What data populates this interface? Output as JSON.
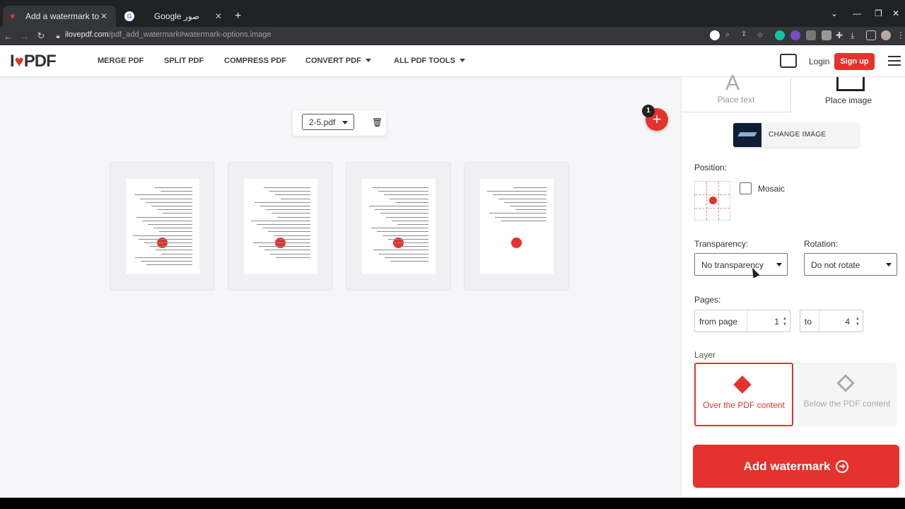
{
  "browser": {
    "tabs": [
      {
        "title": "Add a watermark to a PDF. Add",
        "active": true
      },
      {
        "title": "Google صور",
        "active": false
      }
    ],
    "url": {
      "domain": "ilovepdf.com",
      "path": "/pdf_add_watermark#watermark-options.image"
    }
  },
  "header": {
    "logo": {
      "left": "I",
      "right": "PDF"
    },
    "menu": [
      {
        "label": "MERGE PDF",
        "dropdown": false
      },
      {
        "label": "SPLIT PDF",
        "dropdown": false
      },
      {
        "label": "COMPRESS PDF",
        "dropdown": false
      },
      {
        "label": "CONVERT PDF",
        "dropdown": true
      },
      {
        "label": "ALL PDF TOOLS",
        "dropdown": true
      }
    ],
    "login": "Login",
    "signup": "Sign up"
  },
  "workspace": {
    "file_select": "2-5.pdf",
    "file_count": "1",
    "add_button": "+",
    "pages": 4
  },
  "panel": {
    "modes": {
      "text": "Place text",
      "image": "Place image"
    },
    "change_image": "CHANGE IMAGE",
    "position_label": "Position:",
    "mosaic_label": "Mosaic",
    "transparency_label": "Transparency:",
    "transparency_value": "No transparency",
    "rotation_label": "Rotation:",
    "rotation_value": "Do not rotate",
    "pages_label": "Pages:",
    "from_label": "from page",
    "from_value": "1",
    "to_label": "to",
    "to_value": "4",
    "layer_label": "Layer",
    "layer_over": "Over the PDF content",
    "layer_below": "Below the PDF content",
    "submit": "Add watermark"
  },
  "colors": {
    "brand": "#e5322d",
    "text": "#333333"
  }
}
